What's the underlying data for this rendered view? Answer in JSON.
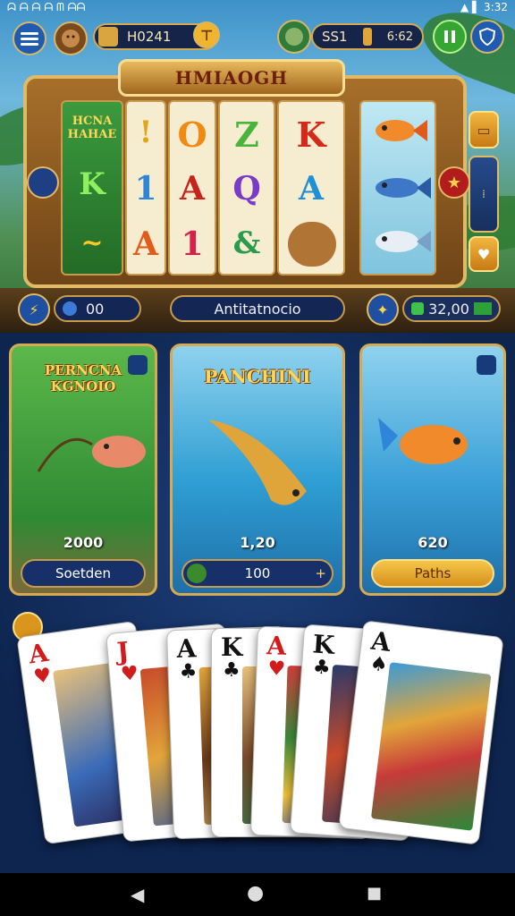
{
  "status_bar": {
    "left_text": "ᗣ ᗩ ᗩ ᗩ  ᗰ ᗩᗩ",
    "right_text": "▲ ▌ 3:32"
  },
  "hud": {
    "menu_icon": "menu-icon",
    "player_coin_value": "H0241",
    "mid_value": "SS1",
    "right_value": "6:62",
    "pause_icon": "pause-icon",
    "shield_icon": "shield-icon"
  },
  "slot": {
    "title": "HMIAOGH",
    "reels": [
      {
        "symbols": [
          "HCNA HAHAE",
          "K",
          "~"
        ]
      },
      {
        "symbols": [
          "!",
          "1",
          "A"
        ]
      },
      {
        "symbols": [
          "O",
          "A",
          "1"
        ]
      },
      {
        "symbols": [
          "Z",
          "Q",
          "&"
        ]
      },
      {
        "symbols": [
          "K",
          "A",
          "lion"
        ]
      }
    ],
    "fish_reel": [
      "fish-orange",
      "fish-blue",
      "fish-white"
    ],
    "left_value": "00",
    "center_label": "Antitatnocio",
    "right_value": "32,00"
  },
  "game_cards": [
    {
      "title": "PERNCNA KGNOIO",
      "value": "2000",
      "button": "Soetden",
      "accent": "#2a8a3a"
    },
    {
      "title": "PANCHINI",
      "value": "1,20",
      "button": "100",
      "accent": "#2e9ed3"
    },
    {
      "title": "",
      "value": "620",
      "button": "Paths",
      "accent": "#3aa0d8"
    }
  ],
  "hand": [
    {
      "rank": "A",
      "suit": "♥",
      "color": "#d21b1b"
    },
    {
      "rank": "J",
      "suit": "♥",
      "color": "#d21b1b"
    },
    {
      "rank": "A",
      "suit": "♣",
      "color": "#111111"
    },
    {
      "rank": "K",
      "suit": "♣",
      "color": "#111111"
    },
    {
      "rank": "A",
      "suit": "♥",
      "color": "#d21b1b"
    },
    {
      "rank": "K",
      "suit": "♣",
      "color": "#111111"
    },
    {
      "rank": "A",
      "suit": "♠",
      "color": "#111111"
    }
  ],
  "nav": {
    "back": "◀",
    "home": "●",
    "recents": "■"
  }
}
